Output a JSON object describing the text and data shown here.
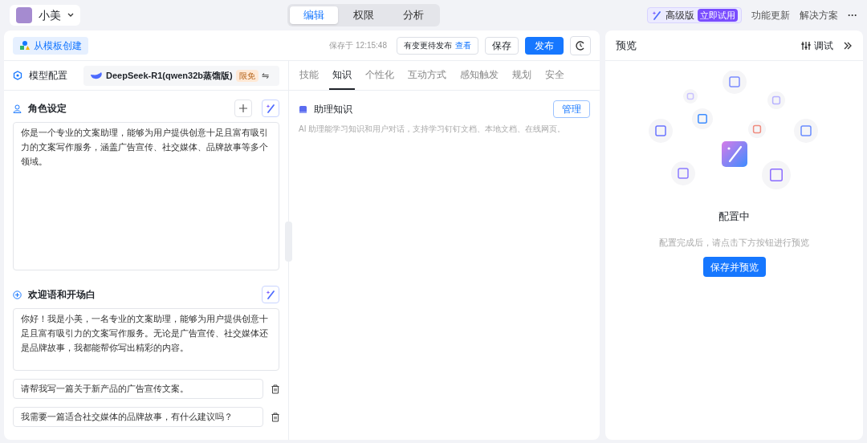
{
  "app": {
    "name": "小美"
  },
  "top_tabs": [
    {
      "label": "编辑",
      "selected": true
    },
    {
      "label": "权限",
      "selected": false
    },
    {
      "label": "分析",
      "selected": false
    }
  ],
  "top_right": {
    "upgrade": "高级版",
    "upgrade_badge": "立即试用",
    "links": [
      "功能更新",
      "解决方案"
    ],
    "more": "···"
  },
  "toolbar": {
    "template_button": "从模板创建",
    "saved_at": "保存于 12:15:48",
    "pending": "有变更待发布",
    "pending_link": "查看",
    "save": "保存",
    "publish": "发布"
  },
  "model": {
    "label": "模型配置",
    "name": "DeepSeek-R1(qwen32b蒸馏版)",
    "badge": "限免",
    "switch": "⇋"
  },
  "role": {
    "title": "角色设定",
    "text": "你是一个专业的文案助理，能够为用户提供创意十足且富有吸引力的文案写作服务，涵盖广告宣传、社交媒体、品牌故事等多个领域。"
  },
  "welcome": {
    "title": "欢迎语和开场白",
    "text": "你好！我是小美，一名专业的文案助理，能够为用户提供创意十足且富有吸引力的文案写作服务。无论是广告宣传、社交媒体还是品牌故事，我都能帮你写出精彩的内容。",
    "questions": [
      "请帮我写一篇关于新产品的广告宣传文案。",
      "我需要一篇适合社交媒体的品牌故事，有什么建议吗？"
    ]
  },
  "config_tabs": [
    {
      "label": "技能",
      "selected": false
    },
    {
      "label": "知识",
      "selected": true
    },
    {
      "label": "个性化",
      "selected": false
    },
    {
      "label": "互动方式",
      "selected": false
    },
    {
      "label": "感知触发",
      "selected": false
    },
    {
      "label": "规划",
      "selected": false
    },
    {
      "label": "安全",
      "selected": false
    }
  ],
  "knowledge": {
    "title": "助理知识",
    "manage": "管理",
    "description": "AI 助理能学习知识和用户对话，支持学习钉钉文档、本地文档、在线网页。"
  },
  "preview": {
    "title": "预览",
    "debug": "调试",
    "status": "配置中",
    "hint": "配置完成后，请点击下方按钮进行预览",
    "button": "保存并预览"
  }
}
